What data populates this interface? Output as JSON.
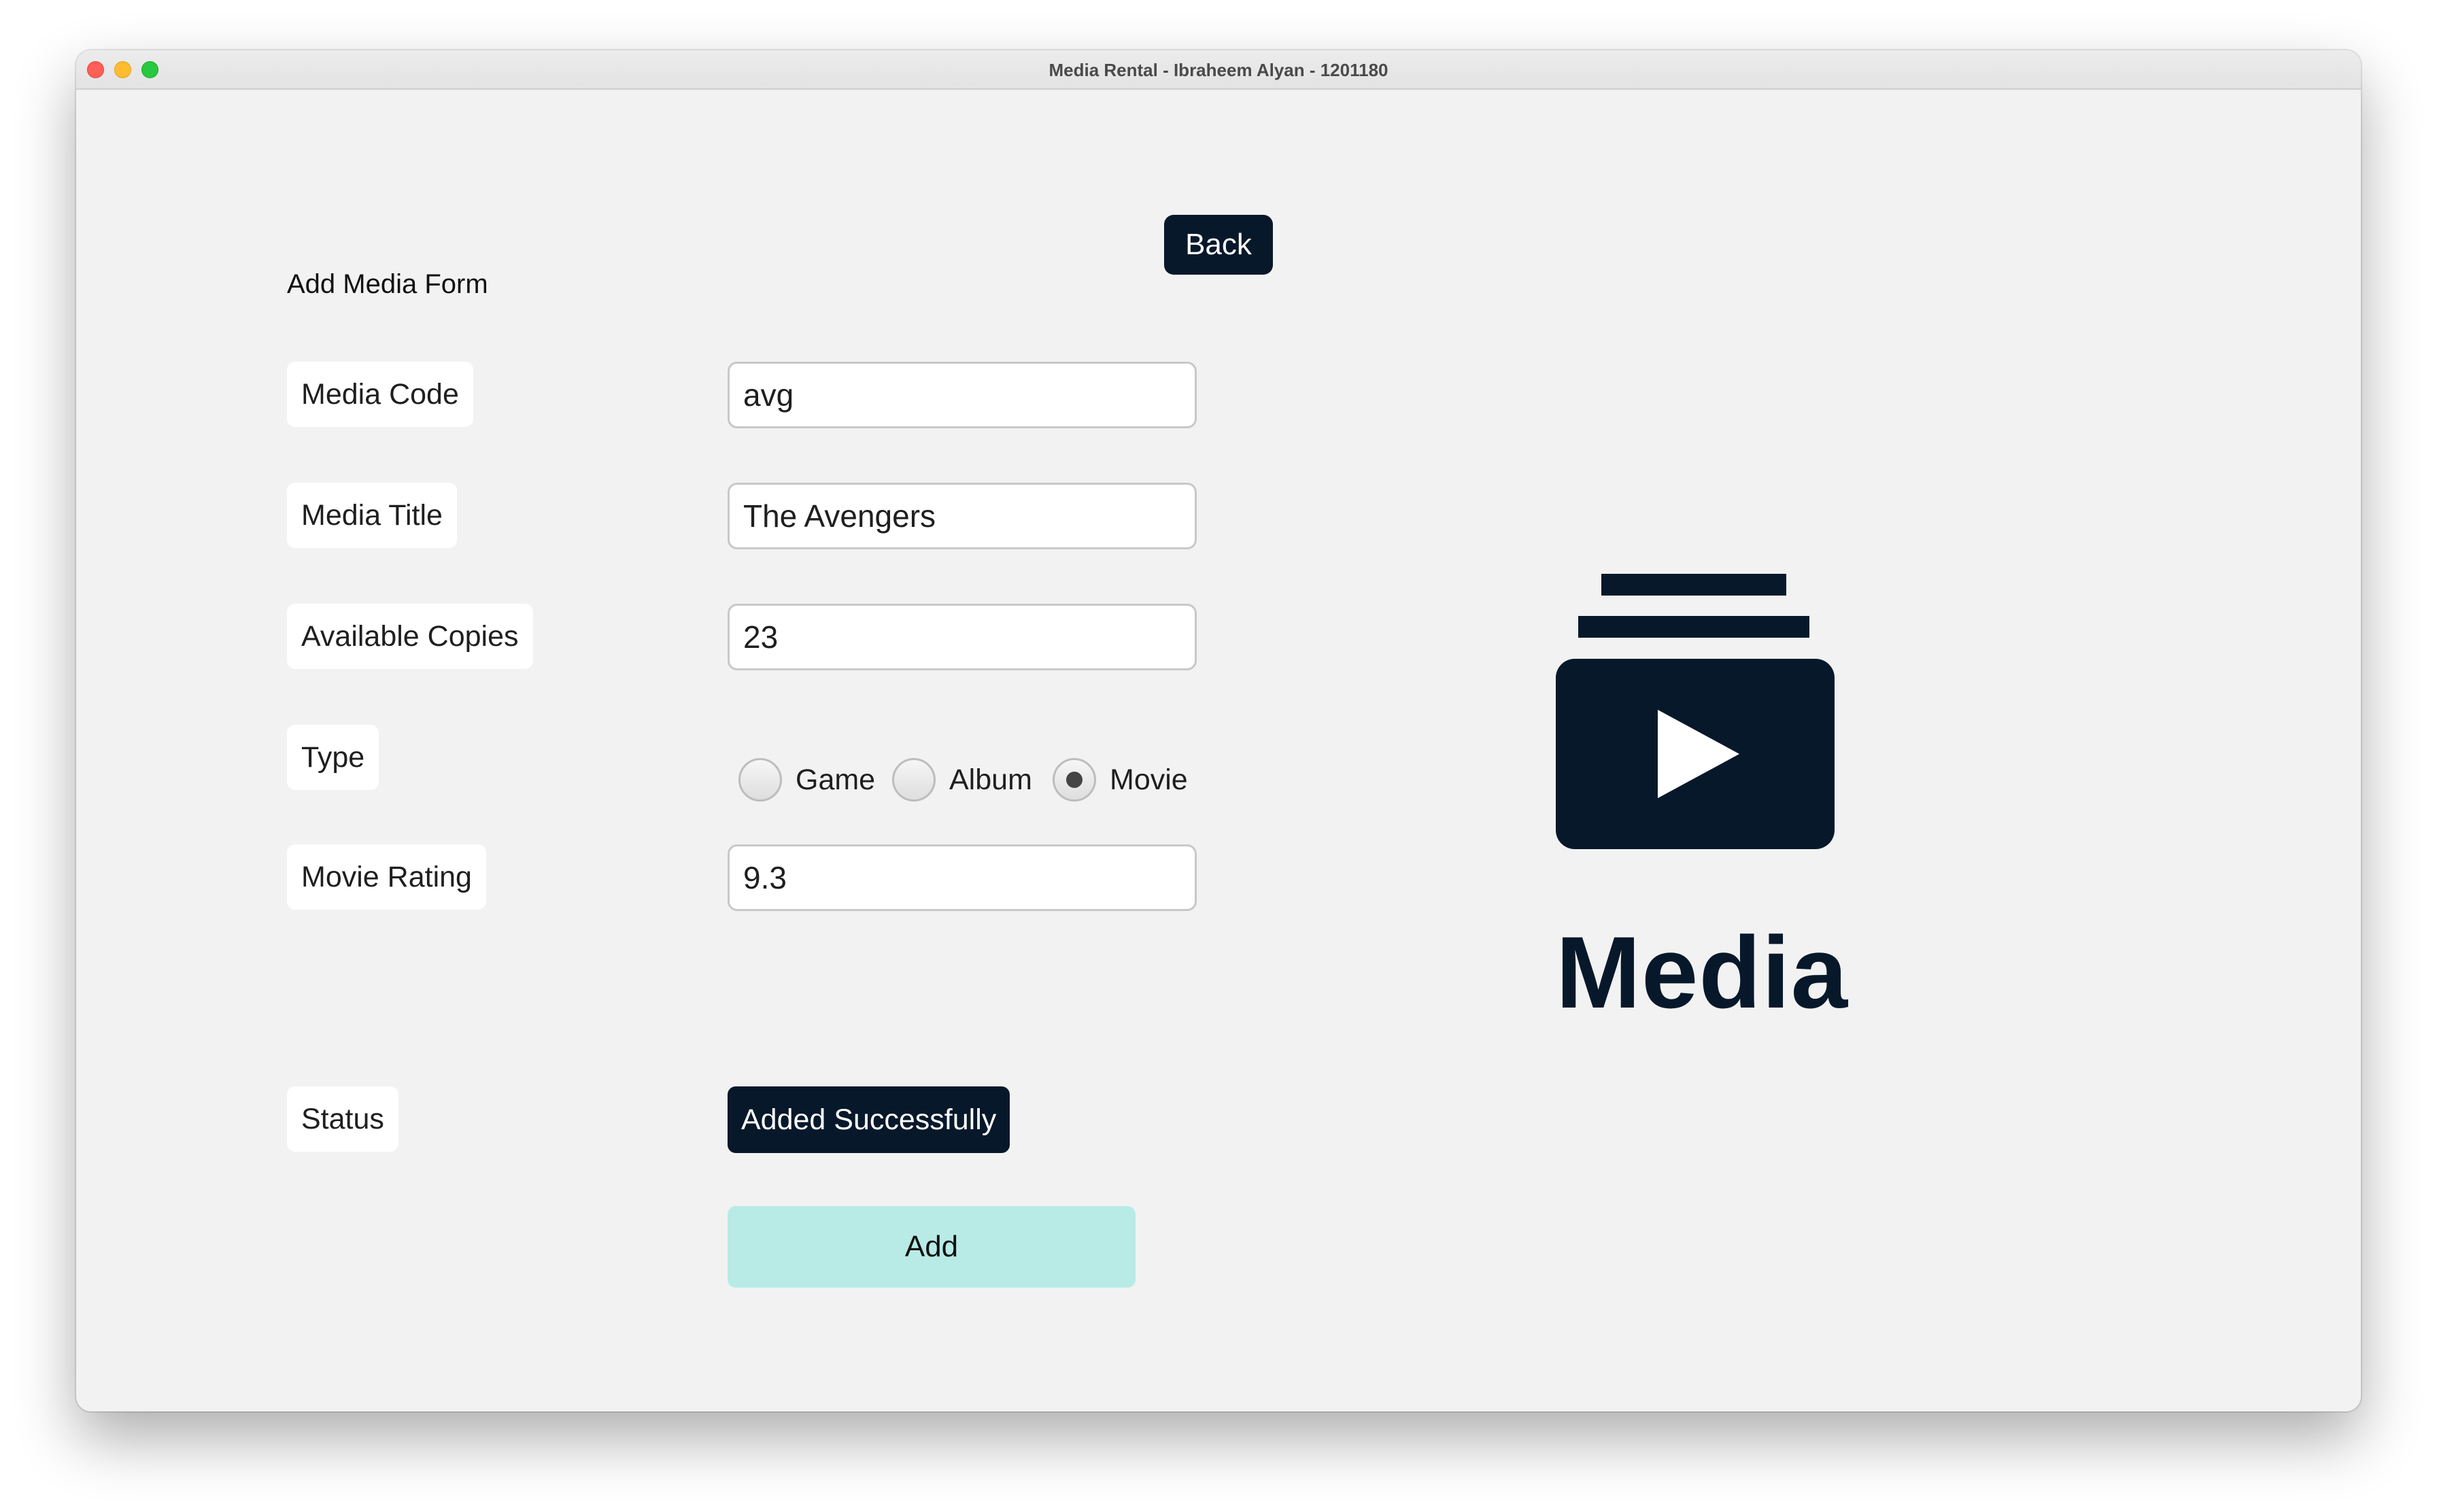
{
  "window": {
    "title": "Media Rental - Ibraheem Alyan - 1201180"
  },
  "form": {
    "title": "Add Media Form",
    "back_label": "Back",
    "fields": {
      "code": {
        "label": "Media Code",
        "value": "avg"
      },
      "title": {
        "label": "Media Title",
        "value": "The Avengers"
      },
      "copies": {
        "label": "Available Copies",
        "value": "23"
      },
      "type": {
        "label": "Type",
        "options": [
          "Game",
          "Album",
          "Movie"
        ],
        "selected": "Movie"
      },
      "rating": {
        "label": "Movie Rating",
        "value": "9.3"
      }
    },
    "status": {
      "label": "Status",
      "value": "Added Successfully"
    },
    "add_label": "Add"
  },
  "branding": {
    "word": "Media",
    "icon": "media-play-icon"
  },
  "colors": {
    "dark": "#06182a",
    "add_button": "#b8ebe6",
    "background": "#f2f2f2"
  }
}
